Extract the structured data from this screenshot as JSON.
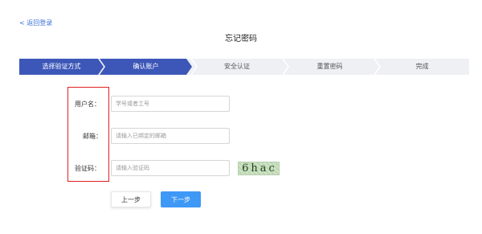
{
  "header": {
    "back_label": "< 返回登录",
    "title": "忘记密码"
  },
  "steps": [
    {
      "label": "选择验证方式",
      "state": "done"
    },
    {
      "label": "确认账户",
      "state": "active"
    },
    {
      "label": "安全认证",
      "state": "pending"
    },
    {
      "label": "重置密码",
      "state": "pending"
    },
    {
      "label": "完成",
      "state": "pending"
    }
  ],
  "form": {
    "username": {
      "label": "用户名：",
      "placeholder": "学号或者工号",
      "value": ""
    },
    "email": {
      "label": "邮箱：",
      "placeholder": "请输入已绑定的邮箱",
      "value": ""
    },
    "captcha": {
      "label": "验证码：",
      "placeholder": "请输入验证码",
      "value": "",
      "image_text": "6hac"
    }
  },
  "buttons": {
    "prev_label": "上一步",
    "next_label": "下一步"
  },
  "colors": {
    "accent": "#3d57b8",
    "link": "#3a6fd8",
    "primary_button": "#3e98f5",
    "highlight": "#e02020",
    "steps_background": "#eef0f4"
  }
}
